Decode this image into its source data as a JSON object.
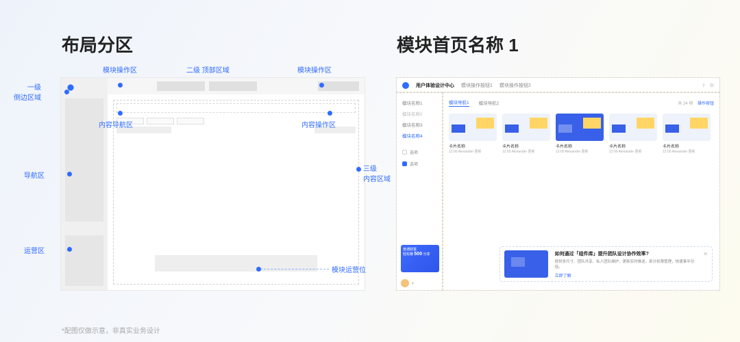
{
  "titles": {
    "left": "布局分区",
    "right": "模块首页名称 1"
  },
  "footnote": "*配图仅做示意，非真实业务设计",
  "left_labels": {
    "sidebar_level": "一级\n侧边区域",
    "top_level": "二级 顶部区域",
    "content_level": "三级\n内容区域",
    "module_op_left": "模块操作区",
    "module_op_right": "模块操作区",
    "content_nav": "内容导航区",
    "content_op": "内容操作区",
    "nav_zone": "导航区",
    "promo_zone": "运营区",
    "module_promo": "模块运营位"
  },
  "ui": {
    "brand": "用户体验设计中心",
    "top_tabs": [
      "模块操作按钮1",
      "模块操作按钮2"
    ],
    "top_icons": [
      "share-icon",
      "settings-icon"
    ],
    "side_menu": [
      {
        "label": "模块名称1",
        "active": false
      },
      {
        "label": "模块名称2",
        "active": false,
        "soft": true
      },
      {
        "label": "模块名称3",
        "active": false
      },
      {
        "label": "模块名称4",
        "active": true
      }
    ],
    "filters": [
      {
        "label": "选项",
        "checked": false
      },
      {
        "label": "选项",
        "checked": true
      }
    ],
    "content_tabs": [
      "模块导航1",
      "模块导航2"
    ],
    "content_meta": {
      "count_label": "共 24 项",
      "action": "操作按钮"
    },
    "cards": [
      {
        "variant": "light",
        "name": "卡片名称",
        "sub": "12:00 Alexander 更新"
      },
      {
        "variant": "light",
        "name": "卡片名称",
        "sub": "12:00 Alexander 更新"
      },
      {
        "variant": "blue",
        "name": "卡片名称",
        "sub": "12:00 Alexander 更新"
      },
      {
        "variant": "light",
        "name": "卡片名称",
        "sub": "12:00 Alexander 更新"
      },
      {
        "variant": "light",
        "name": "卡片名称",
        "sub": "12:00 Alexander 更新"
      }
    ],
    "side_promo": {
      "line1": "普通财富",
      "line2_prefix": "轻松赚",
      "amount": "500",
      "suffix": "分享"
    },
    "promo_card": {
      "title": "如何通过「组件库」提升团队设计协作效率?",
      "desc": "提供多尺寸、团队共享、私人团队维护、更新实时推送，部分权限管理，快速事半功倍。",
      "link": "立即了解"
    }
  }
}
